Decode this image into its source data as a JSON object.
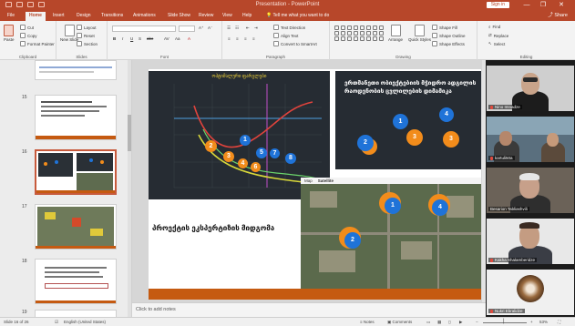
{
  "window": {
    "title": "Presentation - PowerPoint",
    "sign_in": "Sign in",
    "minimize": "—",
    "restore": "❐",
    "close": "✕"
  },
  "ribbon_tabs": [
    {
      "label": "File",
      "active": false
    },
    {
      "label": "Home",
      "active": true
    },
    {
      "label": "Insert",
      "active": false
    },
    {
      "label": "Design",
      "active": false
    },
    {
      "label": "Transitions",
      "active": false
    },
    {
      "label": "Animations",
      "active": false
    },
    {
      "label": "Slide Show",
      "active": false
    },
    {
      "label": "Review",
      "active": false
    },
    {
      "label": "View",
      "active": false
    },
    {
      "label": "Help",
      "active": false
    }
  ],
  "tell_me": "Tell me what you want to do",
  "share": "Share",
  "ribbon": {
    "clipboard": {
      "paste": "Paste",
      "cut": "Cut",
      "copy": "Copy",
      "format_painter": "Format Painter",
      "group": "Clipboard"
    },
    "slides": {
      "new_slide": "New Slide",
      "layout": "Layout",
      "reset": "Reset",
      "section": "Section",
      "group": "Slides"
    },
    "font": {
      "group": "Font",
      "bold": "B",
      "italic": "I",
      "underline": "U",
      "strike": "S",
      "shadow": "abc"
    },
    "paragraph": {
      "group": "Paragraph",
      "text_direction": "Text Direction",
      "align_text": "Align Text",
      "smartart": "Convert to SmartArt"
    },
    "drawing": {
      "group": "Drawing",
      "arrange": "Arrange",
      "quick_styles": "Quick Styles",
      "shape_fill": "Shape Fill",
      "shape_outline": "Shape Outline",
      "shape_effects": "Shape Effects"
    },
    "editing": {
      "group": "Editing",
      "find": "Find",
      "replace": "Replace",
      "select": "Select"
    }
  },
  "thumbnails": [
    {
      "num": "15",
      "selected": false
    },
    {
      "num": "16",
      "selected": true
    },
    {
      "num": "17",
      "selected": false
    },
    {
      "num": "18",
      "selected": false
    },
    {
      "num": "19",
      "selected": false
    }
  ],
  "slide": {
    "chart_title": "ოპტიმალური ფარგლები",
    "info_text": "ერთმანეთი ობიექტებიის მჭიდრო ადგილის რაოდენობის ცვლილების დიმამიკა",
    "caption": "პროექტის ეკსპერტიზის მიდგომა",
    "map_tabs": [
      "Map",
      "Satellite"
    ],
    "chart_bubbles": [
      {
        "label": "1",
        "color": "blue"
      },
      {
        "label": "2",
        "color": "orange"
      },
      {
        "label": "3",
        "color": "orange"
      },
      {
        "label": "4",
        "color": "orange"
      },
      {
        "label": "5",
        "color": "blue"
      },
      {
        "label": "6",
        "color": "orange"
      },
      {
        "label": "7",
        "color": "blue"
      },
      {
        "label": "8",
        "color": "blue"
      }
    ],
    "info_bubbles": [
      {
        "label": "1",
        "color": "blue"
      },
      {
        "label": "2",
        "color": "blue"
      },
      {
        "label": "3",
        "color": "orange"
      },
      {
        "label": "4",
        "color": "blue"
      },
      {
        "label": "5",
        "color": "orange"
      }
    ],
    "map_bubbles": [
      {
        "label": "1",
        "color": "blue"
      },
      {
        "label": "2",
        "color": "blue"
      },
      {
        "label": "4",
        "color": "blue"
      }
    ]
  },
  "notes_placeholder": "Click to add notes",
  "participants": [
    {
      "name": "Nino Imnadze",
      "muted": true
    },
    {
      "name": "kartuli50a",
      "muted": true
    },
    {
      "name": "Besarion Tabliashvili",
      "muted": false
    },
    {
      "name": "Kakha Shalamberidze",
      "muted": true
    },
    {
      "name": "Nukri Ebralidze",
      "muted": true
    }
  ],
  "status": {
    "slide_of": "Slide 16 of 26",
    "language": "English (United States)",
    "notes": "Notes",
    "comments": "Comments",
    "zoom": "53%"
  },
  "colors": {
    "accent": "#b7472a",
    "slide_band": "#c55a11",
    "bubble_blue": "#1f73d8",
    "bubble_orange": "#f28c1b"
  }
}
